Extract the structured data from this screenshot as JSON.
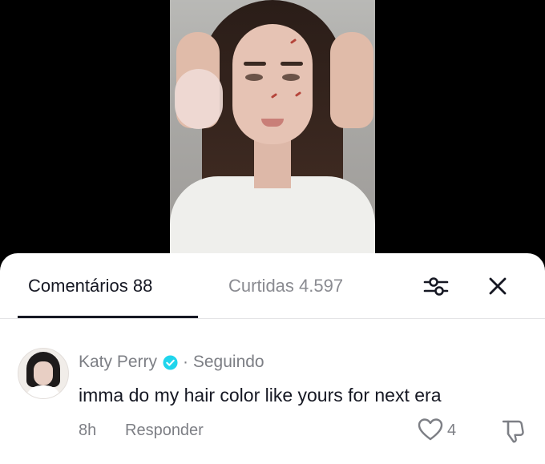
{
  "tabs": {
    "comments_label": "Comentários 88",
    "likes_label": "Curtidas 4.597"
  },
  "icons": {
    "filter": "sliders-icon",
    "close": "close-icon",
    "verified": "verified-badge-icon",
    "like": "heart-outline-icon",
    "dislike": "thumbs-down-icon"
  },
  "comment": {
    "author": "Katy Perry",
    "relation": "· Seguindo",
    "text": "imma do my hair color like yours for next era",
    "age": "8h",
    "reply_label": "Responder",
    "like_count": "4"
  },
  "colors": {
    "verified": "#20d5ec",
    "text_primary": "#161823",
    "text_secondary": "#7d7f85"
  }
}
